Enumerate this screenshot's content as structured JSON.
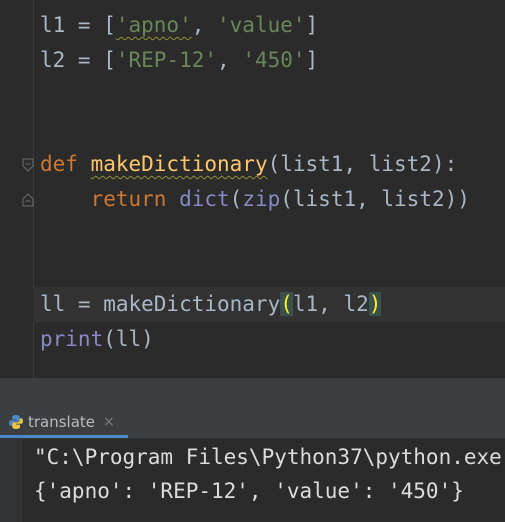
{
  "editor": {
    "lines": [
      {
        "id": "l1",
        "tokens": [
          {
            "t": "l1 = [",
            "c": "plain"
          },
          {
            "t": "'apno'",
            "c": "str",
            "sq": true
          },
          {
            "t": ", ",
            "c": "plain"
          },
          {
            "t": "'value'",
            "c": "str"
          },
          {
            "t": "]",
            "c": "plain"
          }
        ]
      },
      {
        "id": "l2",
        "tokens": [
          {
            "t": "l2 = [",
            "c": "plain"
          },
          {
            "t": "'REP-12'",
            "c": "str"
          },
          {
            "t": ", ",
            "c": "plain"
          },
          {
            "t": "'450'",
            "c": "str"
          },
          {
            "t": "]",
            "c": "plain"
          }
        ]
      },
      {
        "id": "def",
        "tokens": [
          {
            "t": "def ",
            "c": "kw"
          },
          {
            "t": "makeDictionary",
            "c": "fn",
            "sq": true
          },
          {
            "t": "(list1, list2):",
            "c": "plain"
          }
        ]
      },
      {
        "id": "return",
        "tokens": [
          {
            "t": "    return ",
            "c": "kw"
          },
          {
            "t": "dict",
            "c": "builtin"
          },
          {
            "t": "(",
            "c": "plain"
          },
          {
            "t": "zip",
            "c": "builtin"
          },
          {
            "t": "(list1, list2))",
            "c": "plain"
          }
        ]
      },
      {
        "id": "ll",
        "tokens": [
          {
            "t": "ll = makeDictionary",
            "c": "plain"
          },
          {
            "t": "(",
            "c": "plain",
            "hl": true
          },
          {
            "t": "l1, l2",
            "c": "plain"
          },
          {
            "t": ")",
            "c": "plain",
            "hl": true
          }
        ]
      },
      {
        "id": "print",
        "tokens": [
          {
            "t": "print",
            "c": "builtin"
          },
          {
            "t": "(ll)",
            "c": "plain"
          }
        ]
      }
    ]
  },
  "run_panel": {
    "tab_label": "translate",
    "close_glyph": "×",
    "console_lines": [
      "\"C:\\Program Files\\Python37\\python.exe",
      "{'apno': 'REP-12', 'value': '450'}"
    ]
  },
  "colors": {
    "background": "#2b2b2b",
    "keyword": "#cc7832",
    "string": "#6a8759",
    "function": "#ffc66d",
    "builtin": "#8888c6",
    "text": "#a9b7c6",
    "tab_accent": "#4a88c7"
  }
}
